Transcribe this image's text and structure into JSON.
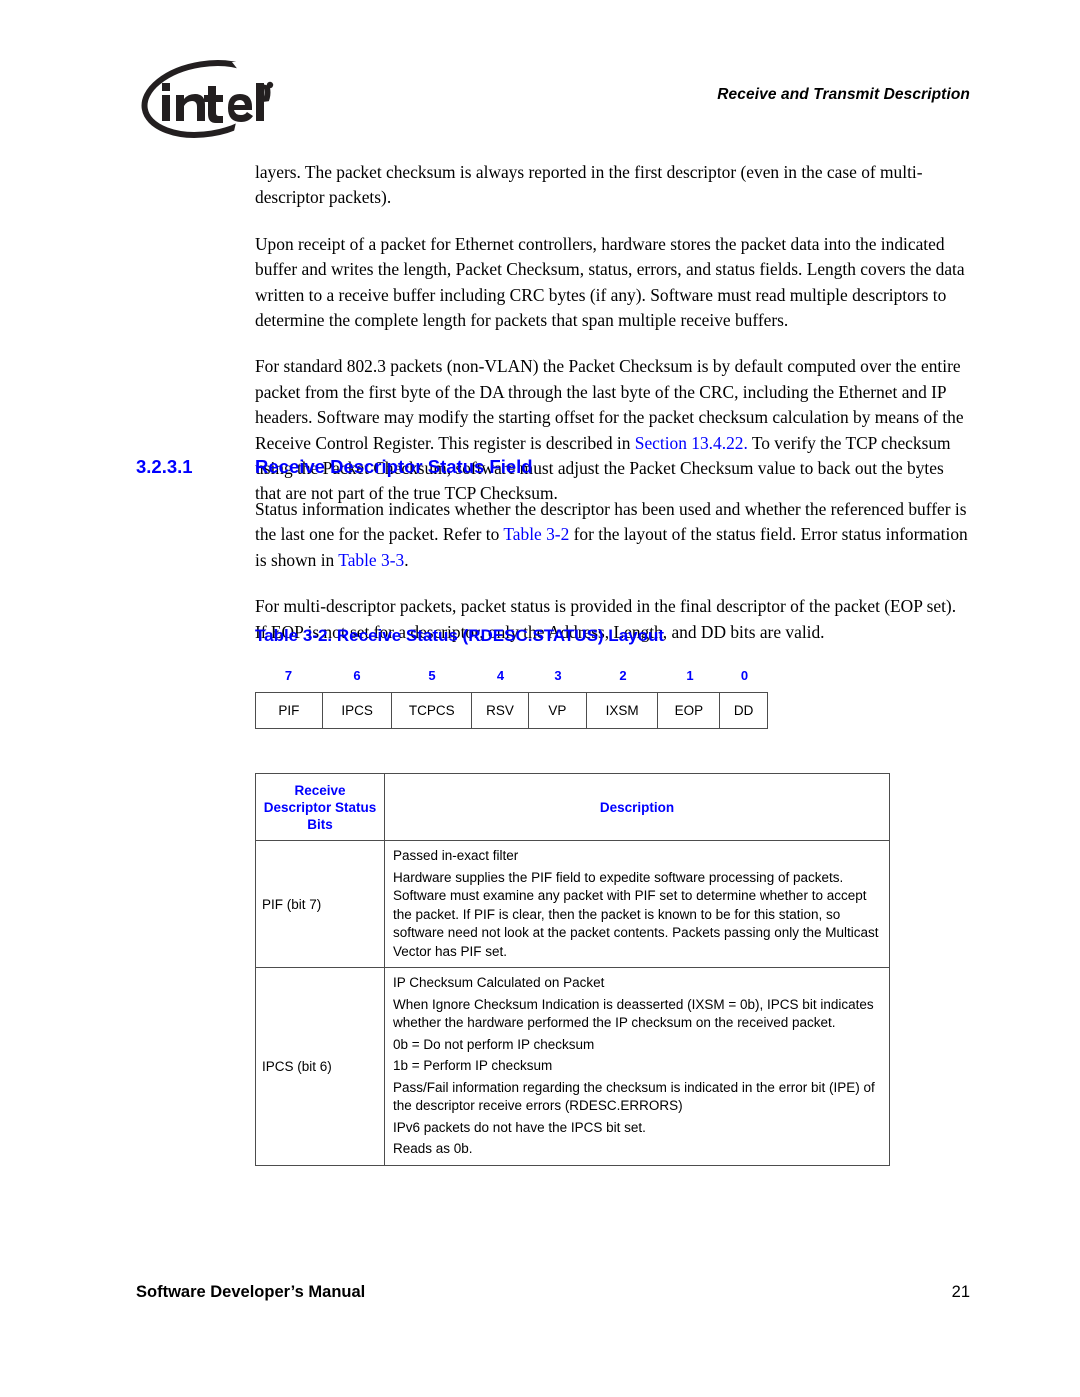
{
  "header": {
    "logo_alt": "intel",
    "title": "Receive and Transmit Description"
  },
  "paragraphs": {
    "p1_a": "layers. The packet checksum is always reported in the first descriptor (even in the case of multi-descriptor packets).",
    "p2": "Upon receipt of a packet for Ethernet controllers, hardware stores the packet data into the indicated buffer and writes the length, Packet Checksum, status, errors, and status fields. Length covers the data written to a receive buffer including CRC bytes (if any). Software must read multiple descriptors to determine the complete length for packets that span multiple receive buffers.",
    "p3_a": "For standard 802.3 packets (non-VLAN) the Packet Checksum is by default computed over the entire packet from the first byte of the DA through the last byte of the CRC, including the Ethernet and IP headers. Software may modify the starting offset for the packet checksum calculation by means of the Receive Control Register. This register is described in ",
    "p3_link": "Section 13.4.22.",
    "p3_b": " To verify the TCP checksum using the Packet Checksum, software must adjust the Packet Checksum value to back out the bytes that are not part of the true TCP Checksum.",
    "p4_a": "Status information indicates whether the descriptor has been used and whether the referenced buffer is the last one for the packet. Refer to ",
    "p4_link1": "Table 3-2",
    "p4_b": " for the layout of the status field. Error status information is shown in ",
    "p4_link2": "Table 3-3",
    "p4_c": "."
  },
  "section": {
    "number": "3.2.3.1",
    "title": "Receive Descriptor Status Field"
  },
  "paragraph5": "For multi-descriptor packets, packet status is provided in the final descriptor of the packet (EOP set). If EOP is not set for a descriptor, only the Address, Length, and DD bits are valid.",
  "table_caption": "Table 3-2. Receive Status (RDESC.STATUS) Layout",
  "bit_layout": {
    "bit_numbers": [
      "7",
      "6",
      "5",
      "4",
      "3",
      "2",
      "1",
      "0"
    ],
    "field_names": [
      "PIF",
      "IPCS",
      "TCPCS",
      "RSV",
      "VP",
      "IXSM",
      "EOP",
      "DD"
    ]
  },
  "desc_table": {
    "headers": {
      "bits": "Receive Descriptor Status Bits",
      "bits_line1": "Receive",
      "bits_line2": "Descriptor Status",
      "bits_line3": "Bits",
      "description": "Description"
    },
    "rows": [
      {
        "bits": "PIF (bit 7)",
        "lines": [
          "Passed in-exact filter",
          "Hardware supplies the PIF field to expedite software processing of packets. Software must examine any packet with PIF set to determine whether to accept the packet. If PIF is clear, then the packet is known to be for this station, so software need not look at the packet contents. Packets passing only the Multicast Vector has PIF set."
        ]
      },
      {
        "bits": "IPCS (bit 6)",
        "lines": [
          "IP Checksum Calculated on Packet",
          "When Ignore Checksum Indication is deasserted (IXSM = 0b), IPCS bit indicates whether the hardware performed the IP checksum on the received packet.",
          "0b = Do not perform IP checksum",
          "1b = Perform IP checksum",
          "Pass/Fail information regarding the checksum is indicated in the error bit (IPE) of the descriptor receive errors (RDESC.ERRORS)",
          "IPv6 packets do not have the IPCS bit set.",
          "Reads as 0b."
        ]
      }
    ]
  },
  "footer": {
    "left": "Software Developer’s Manual",
    "page_number": "21"
  },
  "colors": {
    "link_blue": "#0000ff",
    "heading_blue": "#0000ff",
    "table_border": "#4d4d4d",
    "text": "#000000"
  }
}
